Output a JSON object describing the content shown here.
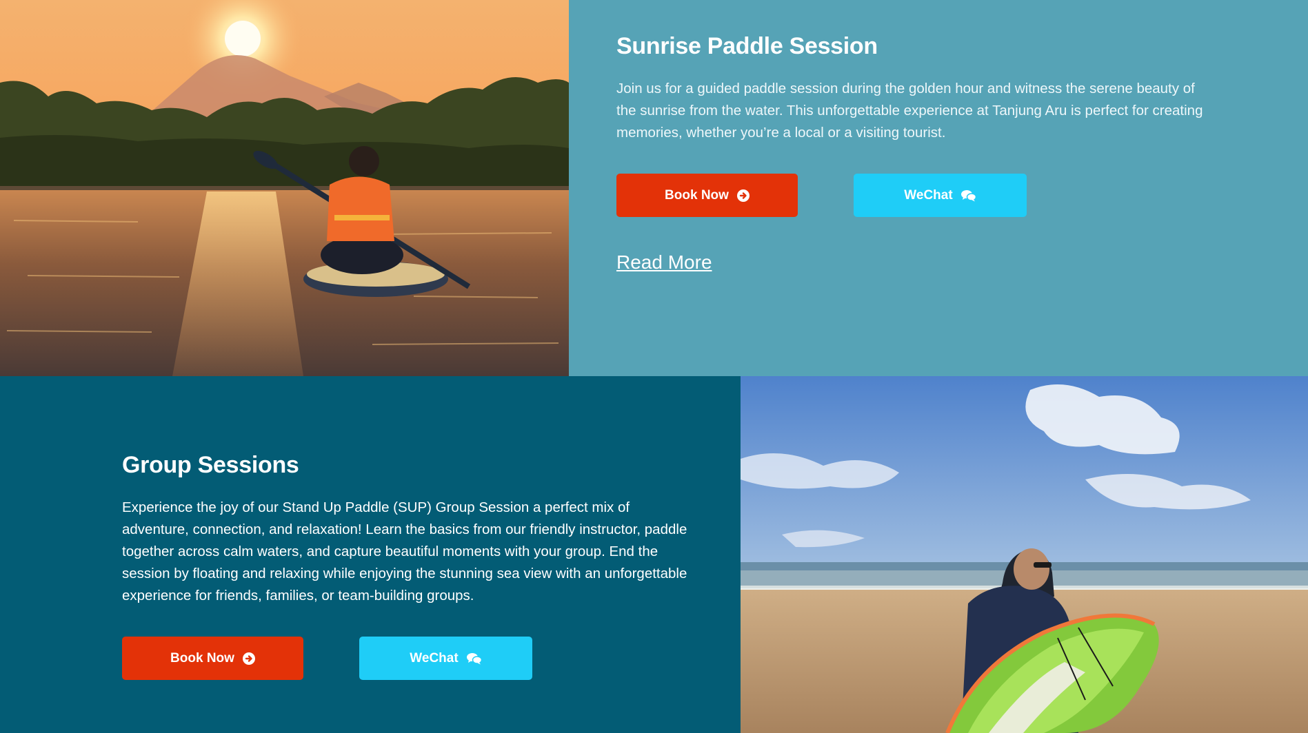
{
  "sunrise": {
    "title": "Sunrise Paddle Session",
    "description": "Join us for a guided paddle session during the golden hour and witness the serene beauty of the sunrise from the water. This unforgettable experience at Tanjung Aru is perfect for creating memories, whether you’re a local or a visiting tourist.",
    "book_label": "Book Now",
    "wechat_label": "WeChat",
    "read_more": "Read More",
    "image_alt": "Paddler kneeling on a paddle board at sunrise with a mountain in the background"
  },
  "group": {
    "title": "Group Sessions",
    "description": "Experience the joy of our Stand Up Paddle (SUP) Group Session a perfect mix of adventure, connection, and relaxation! Learn the basics from our friendly instructor, paddle together across calm waters, and capture beautiful moments with your group. End the session by floating and relaxing while enjoying the stunning sea view with an unforgettable experience for friends, families, or team-building groups.",
    "book_label": "Book Now",
    "wechat_label": "WeChat",
    "image_alt": "Man on a beach holding a green paddle board"
  },
  "icons": {
    "book": "arrow-circle-right-icon",
    "wechat": "chat-bubbles-icon"
  },
  "colors": {
    "sunrise_bg": "#56a3b6",
    "group_bg": "#035c75",
    "book_button": "#e33208",
    "wechat_button": "#1fcdf7"
  }
}
